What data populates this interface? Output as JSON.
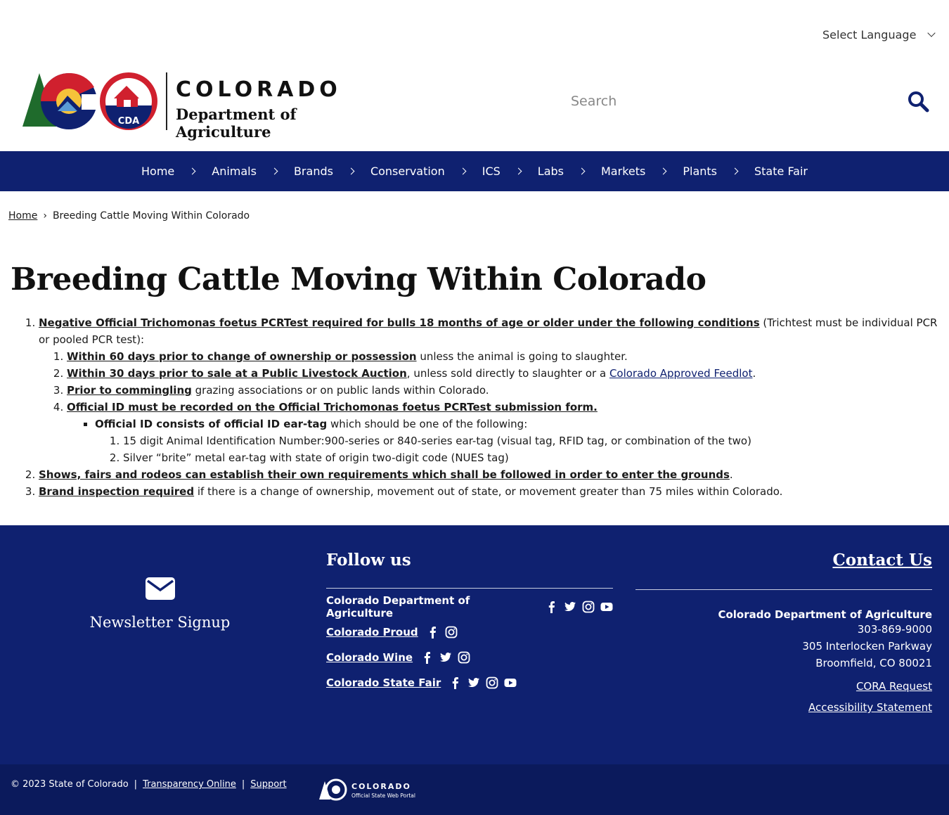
{
  "header": {
    "language_label": "Select Language",
    "logo_word": "COLORADO",
    "logo_dept": "Department of Agriculture",
    "logo_badge": "CDA",
    "search_placeholder": "Search"
  },
  "nav": {
    "items": [
      {
        "label": "Home"
      },
      {
        "label": "Animals"
      },
      {
        "label": "Brands"
      },
      {
        "label": "Conservation"
      },
      {
        "label": "ICS"
      },
      {
        "label": "Labs"
      },
      {
        "label": "Markets"
      },
      {
        "label": "Plants"
      },
      {
        "label": "State Fair"
      }
    ]
  },
  "breadcrumb": {
    "home": "Home",
    "sep": "›",
    "current": "Breeding Cattle Moving Within Colorado"
  },
  "page": {
    "title": "Breeding Cattle Moving Within Colorado",
    "item1_strong": "Negative Official Trichomonas foetus PCRTest required for bulls 18 months of age or older under the following conditions",
    "item1_rest": " (Trichtest must be individual PCR or pooled PCR test):",
    "sub1_strong": "Within 60 days prior to change of ownership or possession",
    "sub1_rest": " unless the animal is going to slaughter.",
    "sub2_strong": "Within 30 days prior to sale at a Public Livestock Auction",
    "sub2_mid": ", unless sold directly to slaughter or a ",
    "sub2_link": "Colorado Approved Feedlot",
    "sub2_end": ".",
    "sub3_strong": "Prior to commingling",
    "sub3_rest": " grazing associations or on public lands within Colorado.",
    "sub4_strong": "Official ID must be recorded on the Official Trichomonas foetus PCRTest submission form.",
    "bullet_strong": "Official ID consists of official ID ear-tag",
    "bullet_rest": " which should be one of the following:",
    "id1": "15 digit Animal Identification Number:900-series or 840-series ear-tag (visual tag, RFID tag, or combination of the two)",
    "id2": "Silver “brite” metal ear-tag with state of origin two-digit code (NUES tag)",
    "item2_strong": "Shows, fairs and rodeos can establish their own requirements which shall be followed in order to enter the grounds",
    "item2_end": ".",
    "item3_strong": "Brand inspection required",
    "item3_rest": " if there is a change of ownership, movement out of state, or movement greater than 75 miles within Colorado."
  },
  "footer": {
    "newsletter": "Newsletter Signup",
    "follow_title": "Follow us",
    "follow_rows": [
      {
        "label": "Colorado Department of Agriculture",
        "icons": [
          "facebook-icon",
          "twitter-icon",
          "instagram-icon",
          "youtube-icon"
        ]
      },
      {
        "label": "Colorado Proud",
        "icons": [
          "facebook-icon",
          "instagram-icon"
        ]
      },
      {
        "label": "Colorado Wine",
        "icons": [
          "facebook-icon",
          "twitter-icon",
          "instagram-icon"
        ]
      },
      {
        "label": "Colorado State Fair",
        "icons": [
          "facebook-icon",
          "twitter-icon",
          "instagram-icon",
          "youtube-icon"
        ]
      }
    ],
    "contact_title": "Contact Us",
    "contact_org": "Colorado Department of Agriculture",
    "contact_phone": "303-869-9000",
    "contact_street": "305 Interlocken Parkway",
    "contact_city": "Broomfield, CO 80021",
    "cora": "CORA Request",
    "accessibility": "Accessibility Statement",
    "copyright": "© 2023 State of Colorado",
    "sep": "|",
    "transparency": "Transparency Online",
    "support": "Support",
    "portal_word": "COLORADO",
    "portal_sub": "Official State Web Portal"
  },
  "colors": {
    "nav_bg": "#0f2170",
    "footer_bg": "#0f2170",
    "bottom_bg": "#0b1a5c",
    "link": "#0f2170"
  }
}
